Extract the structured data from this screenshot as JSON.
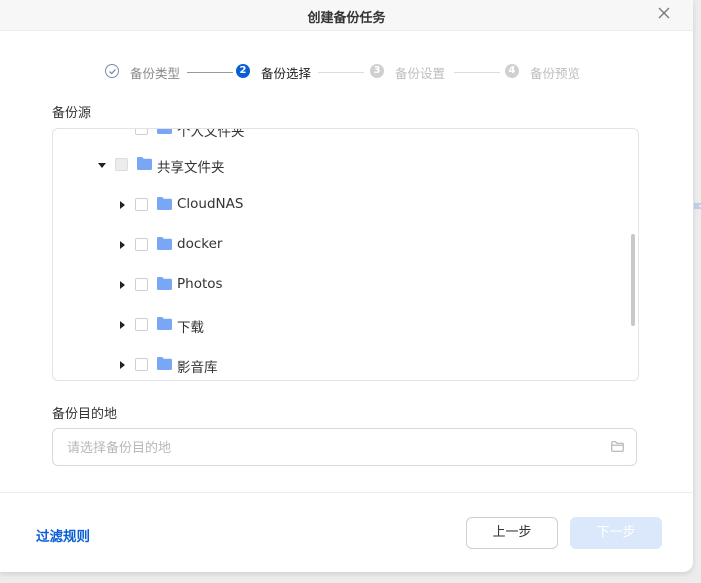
{
  "dialog": {
    "title": "创建备份任务"
  },
  "steps": [
    {
      "label": "备份类型",
      "state": "done",
      "number": "✓"
    },
    {
      "label": "备份选择",
      "state": "active",
      "number": "2"
    },
    {
      "label": "备份设置",
      "state": "todo",
      "number": "3"
    },
    {
      "label": "备份预览",
      "state": "todo",
      "number": "4"
    }
  ],
  "source": {
    "label": "备份源",
    "partial_item": "个人文件夹",
    "group": {
      "name": "共享文件夹",
      "expanded": true
    },
    "items": [
      {
        "name": "CloudNAS"
      },
      {
        "name": "docker"
      },
      {
        "name": "Photos"
      },
      {
        "name": "下载"
      },
      {
        "name": "影音库"
      }
    ]
  },
  "destination": {
    "label": "备份目的地",
    "placeholder": "请选择备份目的地",
    "value": ""
  },
  "footer": {
    "filter_link": "过滤规则",
    "prev_button": "上一步",
    "next_button": "下一步"
  },
  "colors": {
    "accent": "#0b5fd6",
    "folder": "#7aa7f5",
    "disabled_button": "#dbe8fb"
  }
}
